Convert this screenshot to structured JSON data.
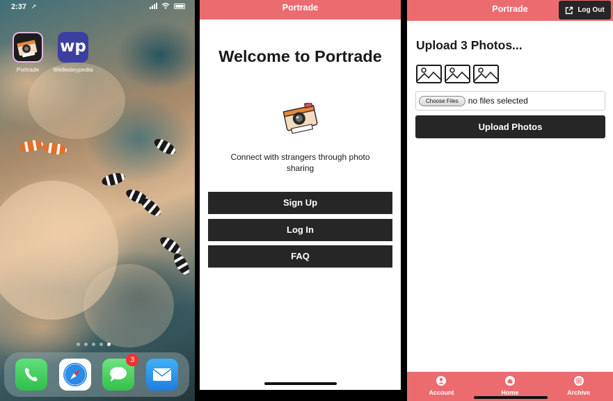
{
  "status": {
    "time": "2:37"
  },
  "home_screen": {
    "apps": [
      {
        "label": "Portrade",
        "icon": "portrade-app-icon"
      },
      {
        "label": "Wellesleypedia",
        "icon": "wellesleypedia-app-icon",
        "glyph": "wp"
      }
    ],
    "dock": [
      {
        "icon": "phone-icon"
      },
      {
        "icon": "safari-icon"
      },
      {
        "icon": "messages-icon",
        "badge": "3"
      },
      {
        "icon": "mail-icon"
      }
    ]
  },
  "welcome_screen": {
    "app_title": "Portrade",
    "heading": "Welcome to Portrade",
    "tagline": "Connect with strangers through photo sharing",
    "buttons": {
      "sign_up": "Sign Up",
      "log_in": "Log In",
      "faq": "FAQ"
    }
  },
  "upload_screen": {
    "app_title": "Portrade",
    "logout_label": "Log Out",
    "heading": "Upload 3 Photos...",
    "choose_files": "Choose Files",
    "no_files": "no files selected",
    "upload_button": "Upload Photos",
    "tabs": [
      {
        "label": "Account",
        "icon": "account-icon"
      },
      {
        "label": "Home",
        "icon": "home-icon"
      },
      {
        "label": "Archive",
        "icon": "archive-grid-icon"
      }
    ]
  },
  "colors": {
    "brand": "#ec6b6f",
    "button": "#262626",
    "badge": "#e8352e"
  }
}
